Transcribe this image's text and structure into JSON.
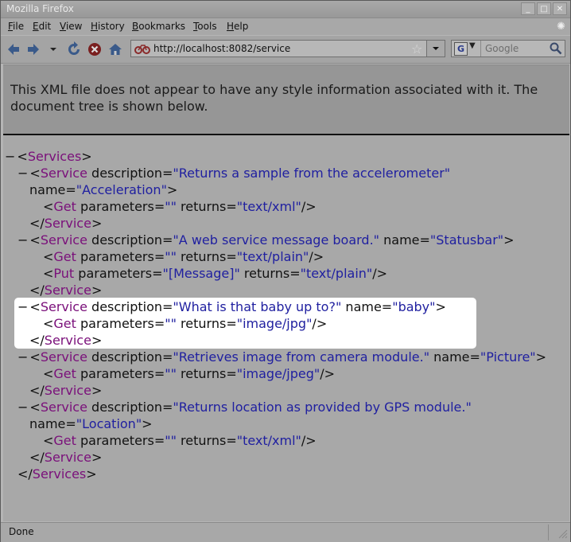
{
  "window": {
    "title": "Mozilla Firefox"
  },
  "window_buttons": [
    "_",
    "□",
    "✕"
  ],
  "menu": [
    {
      "label": "File",
      "u": "F",
      "rest": "ile"
    },
    {
      "label": "Edit",
      "u": "E",
      "rest": "dit"
    },
    {
      "label": "View",
      "u": "V",
      "rest": "iew"
    },
    {
      "label": "History",
      "u": "H",
      "rest": "istory"
    },
    {
      "label": "Bookmarks",
      "u": "B",
      "rest": "ookmarks"
    },
    {
      "label": "Tools",
      "u": "T",
      "rest": "ools"
    },
    {
      "label": "Help",
      "u": "H",
      "rest": "elp"
    }
  ],
  "nav": {
    "url": "http://localhost:8082/service",
    "search_placeholder": "Google",
    "search_engine_letter": "G"
  },
  "page": {
    "notice": "This XML file does not appear to have any style information associated with it. The document tree is shown below."
  },
  "xml_lines": [
    {
      "segs": [
        [
          "m",
          "−"
        ],
        [
          "p",
          "<"
        ],
        [
          "t",
          "Services"
        ],
        [
          "p",
          ">"
        ]
      ]
    },
    {
      "segs": [
        [
          "m",
          "−"
        ],
        [
          "p",
          "<"
        ],
        [
          "t",
          "Service"
        ],
        [
          "p",
          " "
        ],
        [
          "a",
          "description"
        ],
        [
          "p",
          "="
        ],
        [
          "v",
          "\"Returns a sample from the accelerometer\""
        ]
      ]
    },
    {
      "segs": [
        [
          "a",
          "name"
        ],
        [
          "p",
          "="
        ],
        [
          "v",
          "\"Acceleration\""
        ],
        [
          "p",
          ">"
        ]
      ]
    },
    {
      "segs": [
        [
          "p",
          "<"
        ],
        [
          "t",
          "Get"
        ],
        [
          "p",
          " "
        ],
        [
          "a",
          "parameters"
        ],
        [
          "p",
          "="
        ],
        [
          "v",
          "\"\""
        ],
        [
          "p",
          " "
        ],
        [
          "a",
          "returns"
        ],
        [
          "p",
          "="
        ],
        [
          "v",
          "\"text/xml\""
        ],
        [
          "p",
          "/>"
        ]
      ]
    },
    {
      "segs": [
        [
          "p",
          "</"
        ],
        [
          "t",
          "Service"
        ],
        [
          "p",
          ">"
        ]
      ]
    },
    {
      "segs": [
        [
          "m",
          "−"
        ],
        [
          "p",
          "<"
        ],
        [
          "t",
          "Service"
        ],
        [
          "p",
          " "
        ],
        [
          "a",
          "description"
        ],
        [
          "p",
          "="
        ],
        [
          "v",
          "\"A web service message board.\""
        ],
        [
          "p",
          " "
        ],
        [
          "a",
          "name"
        ],
        [
          "p",
          "="
        ],
        [
          "v",
          "\"Statusbar\""
        ],
        [
          "p",
          ">"
        ]
      ]
    },
    {
      "segs": [
        [
          "p",
          "<"
        ],
        [
          "t",
          "Get"
        ],
        [
          "p",
          " "
        ],
        [
          "a",
          "parameters"
        ],
        [
          "p",
          "="
        ],
        [
          "v",
          "\"\""
        ],
        [
          "p",
          " "
        ],
        [
          "a",
          "returns"
        ],
        [
          "p",
          "="
        ],
        [
          "v",
          "\"text/plain\""
        ],
        [
          "p",
          "/>"
        ]
      ]
    },
    {
      "segs": [
        [
          "p",
          "<"
        ],
        [
          "t",
          "Put"
        ],
        [
          "p",
          " "
        ],
        [
          "a",
          "parameters"
        ],
        [
          "p",
          "="
        ],
        [
          "v",
          "\"[Message]\""
        ],
        [
          "p",
          " "
        ],
        [
          "a",
          "returns"
        ],
        [
          "p",
          "="
        ],
        [
          "v",
          "\"text/plain\""
        ],
        [
          "p",
          "/>"
        ]
      ]
    },
    {
      "segs": [
        [
          "p",
          "</"
        ],
        [
          "t",
          "Service"
        ],
        [
          "p",
          ">"
        ]
      ]
    },
    {
      "segs": [
        [
          "m",
          "−"
        ],
        [
          "p",
          "<"
        ],
        [
          "t",
          "Service"
        ],
        [
          "p",
          " "
        ],
        [
          "a",
          "description"
        ],
        [
          "p",
          "="
        ],
        [
          "v",
          "\"What is that baby up to?\""
        ],
        [
          "p",
          " "
        ],
        [
          "a",
          "name"
        ],
        [
          "p",
          "="
        ],
        [
          "v",
          "\"baby\""
        ],
        [
          "p",
          ">"
        ]
      ]
    },
    {
      "segs": [
        [
          "p",
          "<"
        ],
        [
          "t",
          "Get"
        ],
        [
          "p",
          " "
        ],
        [
          "a",
          "parameters"
        ],
        [
          "p",
          "="
        ],
        [
          "v",
          "\"\""
        ],
        [
          "p",
          " "
        ],
        [
          "a",
          "returns"
        ],
        [
          "p",
          "="
        ],
        [
          "v",
          "\"image/jpg\""
        ],
        [
          "p",
          "/>"
        ]
      ]
    },
    {
      "segs": [
        [
          "p",
          "</"
        ],
        [
          "t",
          "Service"
        ],
        [
          "p",
          ">"
        ]
      ]
    },
    {
      "segs": [
        [
          "m",
          "−"
        ],
        [
          "p",
          "<"
        ],
        [
          "t",
          "Service"
        ],
        [
          "p",
          " "
        ],
        [
          "a",
          "description"
        ],
        [
          "p",
          "="
        ],
        [
          "v",
          "\"Retrieves image from camera module.\""
        ],
        [
          "p",
          " "
        ],
        [
          "a",
          "name"
        ],
        [
          "p",
          "="
        ],
        [
          "v",
          "\"Picture\""
        ],
        [
          "p",
          ">"
        ]
      ]
    },
    {
      "segs": [
        [
          "p",
          "<"
        ],
        [
          "t",
          "Get"
        ],
        [
          "p",
          " "
        ],
        [
          "a",
          "parameters"
        ],
        [
          "p",
          "="
        ],
        [
          "v",
          "\"\""
        ],
        [
          "p",
          " "
        ],
        [
          "a",
          "returns"
        ],
        [
          "p",
          "="
        ],
        [
          "v",
          "\"image/jpeg\""
        ],
        [
          "p",
          "/>"
        ]
      ]
    },
    {
      "segs": [
        [
          "p",
          "</"
        ],
        [
          "t",
          "Service"
        ],
        [
          "p",
          ">"
        ]
      ]
    },
    {
      "segs": [
        [
          "m",
          "−"
        ],
        [
          "p",
          "<"
        ],
        [
          "t",
          "Service"
        ],
        [
          "p",
          " "
        ],
        [
          "a",
          "description"
        ],
        [
          "p",
          "="
        ],
        [
          "v",
          "\"Returns location as provided by GPS module.\""
        ]
      ]
    },
    {
      "segs": [
        [
          "a",
          "name"
        ],
        [
          "p",
          "="
        ],
        [
          "v",
          "\"Location\""
        ],
        [
          "p",
          ">"
        ]
      ]
    },
    {
      "segs": [
        [
          "p",
          "<"
        ],
        [
          "t",
          "Get"
        ],
        [
          "p",
          " "
        ],
        [
          "a",
          "parameters"
        ],
        [
          "p",
          "="
        ],
        [
          "v",
          "\"\""
        ],
        [
          "p",
          " "
        ],
        [
          "a",
          "returns"
        ],
        [
          "p",
          "="
        ],
        [
          "v",
          "\"text/xml\""
        ],
        [
          "p",
          "/>"
        ]
      ]
    },
    {
      "segs": [
        [
          "p",
          "</"
        ],
        [
          "t",
          "Service"
        ],
        [
          "p",
          ">"
        ]
      ]
    },
    {
      "segs": [
        [
          "p",
          "</"
        ],
        [
          "t",
          "Services"
        ],
        [
          "p",
          ">"
        ]
      ]
    }
  ],
  "status": {
    "text": "Done"
  },
  "colors": {
    "tag": "#7a0f7a",
    "attr_value": "#2020a0",
    "highlight": "#ffffff"
  },
  "icons": [
    "back-arrow-icon",
    "forward-arrow-icon",
    "history-dropdown-icon",
    "reload-icon",
    "stop-icon",
    "home-icon",
    "site-favicon-icon",
    "bookmark-star-icon",
    "url-dropdown-icon",
    "google-engine-icon",
    "search-magnifier-icon",
    "throbber-icon",
    "resize-grip-icon"
  ]
}
